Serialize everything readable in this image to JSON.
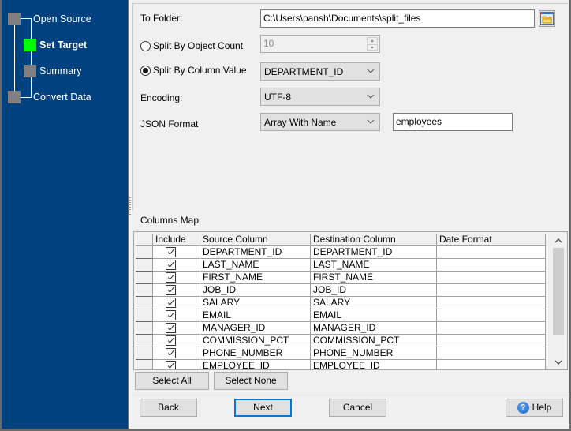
{
  "wizard_steps": [
    {
      "label": "Open Source",
      "state": "done"
    },
    {
      "label": "Set Target",
      "state": "active"
    },
    {
      "label": "Summary",
      "state": "pending"
    },
    {
      "label": "Convert Data",
      "state": "pending"
    }
  ],
  "form": {
    "to_folder_label": "To Folder:",
    "to_folder_value": "C:\\Users\\pansh\\Documents\\split_files",
    "split_by_count_label": "Split By Object Count",
    "split_by_count_value": "10",
    "split_by_count_selected": false,
    "split_by_column_label": "Split By Column Value",
    "split_by_column_value": "DEPARTMENT_ID",
    "split_by_column_selected": true,
    "encoding_label": "Encoding:",
    "encoding_value": "UTF-8",
    "json_format_label": "JSON Format",
    "json_format_value": "Array With Name",
    "json_name_value": "employees"
  },
  "columns_map": {
    "title": "Columns Map",
    "headers": [
      "Include",
      "Source Column",
      "Destination Column",
      "Date Format"
    ],
    "rows": [
      {
        "include": true,
        "source": "DEPARTMENT_ID",
        "destination": "DEPARTMENT_ID",
        "date_format": ""
      },
      {
        "include": true,
        "source": "LAST_NAME",
        "destination": "LAST_NAME",
        "date_format": ""
      },
      {
        "include": true,
        "source": "FIRST_NAME",
        "destination": "FIRST_NAME",
        "date_format": ""
      },
      {
        "include": true,
        "source": "JOB_ID",
        "destination": "JOB_ID",
        "date_format": ""
      },
      {
        "include": true,
        "source": "SALARY",
        "destination": "SALARY",
        "date_format": ""
      },
      {
        "include": true,
        "source": "EMAIL",
        "destination": "EMAIL",
        "date_format": ""
      },
      {
        "include": true,
        "source": "MANAGER_ID",
        "destination": "MANAGER_ID",
        "date_format": ""
      },
      {
        "include": true,
        "source": "COMMISSION_PCT",
        "destination": "COMMISSION_PCT",
        "date_format": ""
      },
      {
        "include": true,
        "source": "PHONE_NUMBER",
        "destination": "PHONE_NUMBER",
        "date_format": ""
      },
      {
        "include": true,
        "source": "EMPLOYEE_ID",
        "destination": "EMPLOYEE_ID",
        "date_format": ""
      }
    ],
    "select_all_label": "Select All",
    "select_none_label": "Select None"
  },
  "footer": {
    "back_label": "Back",
    "next_label": "Next",
    "cancel_label": "Cancel",
    "help_label": "Help"
  },
  "colors": {
    "nav_background": "#00417f",
    "active_step": "#00ff00",
    "pending_step": "#808080",
    "focus_border": "#0078d7"
  }
}
